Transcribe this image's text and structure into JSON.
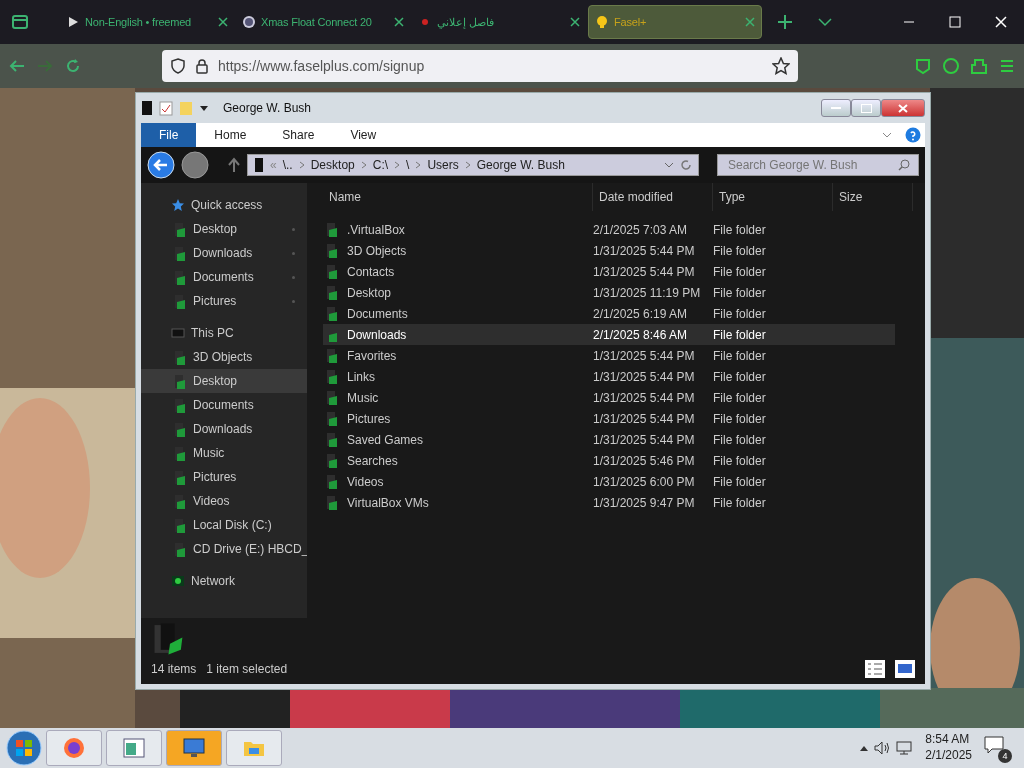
{
  "browser": {
    "tabs": [
      {
        "title": "Non-English • freemed",
        "kind": "play",
        "selected": false
      },
      {
        "title": "Xmas Float Connect 20",
        "kind": "wordpress",
        "selected": false
      },
      {
        "title": "فاصل إعلاني",
        "kind": "dot",
        "selected": false
      },
      {
        "title": "Fasel+",
        "kind": "bulb",
        "selected": true
      }
    ],
    "url": "https://www.faselplus.com/signup"
  },
  "explorer": {
    "title": "George W. Bush",
    "ribbon_tabs": [
      {
        "label": "File",
        "selected": true
      },
      {
        "label": "Home",
        "selected": false
      },
      {
        "label": "Share",
        "selected": false
      },
      {
        "label": "View",
        "selected": false
      }
    ],
    "breadcrumb": [
      "«",
      "\\..",
      "Desktop",
      "C:\\",
      "\\",
      "Users",
      "George W. Bush"
    ],
    "search": {
      "placeholder": "Search George W. Bush"
    },
    "sidebar": [
      {
        "label": "Quick access",
        "kind": "star",
        "selected": false,
        "children": [
          {
            "label": "Desktop",
            "selected": false,
            "pinned": true
          },
          {
            "label": "Downloads",
            "selected": false,
            "pinned": true
          },
          {
            "label": "Documents",
            "selected": false,
            "pinned": true
          },
          {
            "label": "Pictures",
            "selected": false,
            "pinned": true
          }
        ]
      },
      {
        "label": "This PC",
        "kind": "pc",
        "selected": false,
        "children": [
          {
            "label": "3D Objects",
            "selected": false
          },
          {
            "label": "Desktop",
            "selected": true
          },
          {
            "label": "Documents",
            "selected": false
          },
          {
            "label": "Downloads",
            "selected": false
          },
          {
            "label": "Music",
            "selected": false
          },
          {
            "label": "Pictures",
            "selected": false
          },
          {
            "label": "Videos",
            "selected": false
          },
          {
            "label": "Local Disk (C:)",
            "selected": false
          },
          {
            "label": "CD Drive (E:) HBCD_",
            "selected": false
          }
        ]
      },
      {
        "label": "Network",
        "kind": "network",
        "selected": false
      }
    ],
    "columns": [
      "Name",
      "Date modified",
      "Type",
      "Size"
    ],
    "rows": [
      {
        "name": ".VirtualBox",
        "date": "2/1/2025 7:03 AM",
        "type": "File folder",
        "selected": false
      },
      {
        "name": "3D Objects",
        "date": "1/31/2025 5:44 PM",
        "type": "File folder",
        "selected": false
      },
      {
        "name": "Contacts",
        "date": "1/31/2025 5:44 PM",
        "type": "File folder",
        "selected": false
      },
      {
        "name": "Desktop",
        "date": "1/31/2025 11:19 PM",
        "type": "File folder",
        "selected": false
      },
      {
        "name": "Documents",
        "date": "2/1/2025 6:19 AM",
        "type": "File folder",
        "selected": false
      },
      {
        "name": "Downloads",
        "date": "2/1/2025 8:46 AM",
        "type": "File folder",
        "selected": true
      },
      {
        "name": "Favorites",
        "date": "1/31/2025 5:44 PM",
        "type": "File folder",
        "selected": false
      },
      {
        "name": "Links",
        "date": "1/31/2025 5:44 PM",
        "type": "File folder",
        "selected": false
      },
      {
        "name": "Music",
        "date": "1/31/2025 5:44 PM",
        "type": "File folder",
        "selected": false
      },
      {
        "name": "Pictures",
        "date": "1/31/2025 5:44 PM",
        "type": "File folder",
        "selected": false
      },
      {
        "name": "Saved Games",
        "date": "1/31/2025 5:44 PM",
        "type": "File folder",
        "selected": false
      },
      {
        "name": "Searches",
        "date": "1/31/2025 5:46 PM",
        "type": "File folder",
        "selected": false
      },
      {
        "name": "Videos",
        "date": "1/31/2025 6:00 PM",
        "type": "File folder",
        "selected": false
      },
      {
        "name": "VirtualBox VMs",
        "date": "1/31/2025 9:47 PM",
        "type": "File folder",
        "selected": false
      }
    ],
    "status_bar": {
      "count": "14 items",
      "selection": "1 item selected"
    }
  },
  "taskbar": {
    "apps": [
      {
        "kind": "firefox",
        "active": false
      },
      {
        "kind": "window",
        "active": false
      },
      {
        "kind": "monitor",
        "active": true
      },
      {
        "kind": "folder",
        "active": false
      }
    ],
    "time": "8:54 AM",
    "date": "2/1/2025",
    "notifications": "4"
  }
}
